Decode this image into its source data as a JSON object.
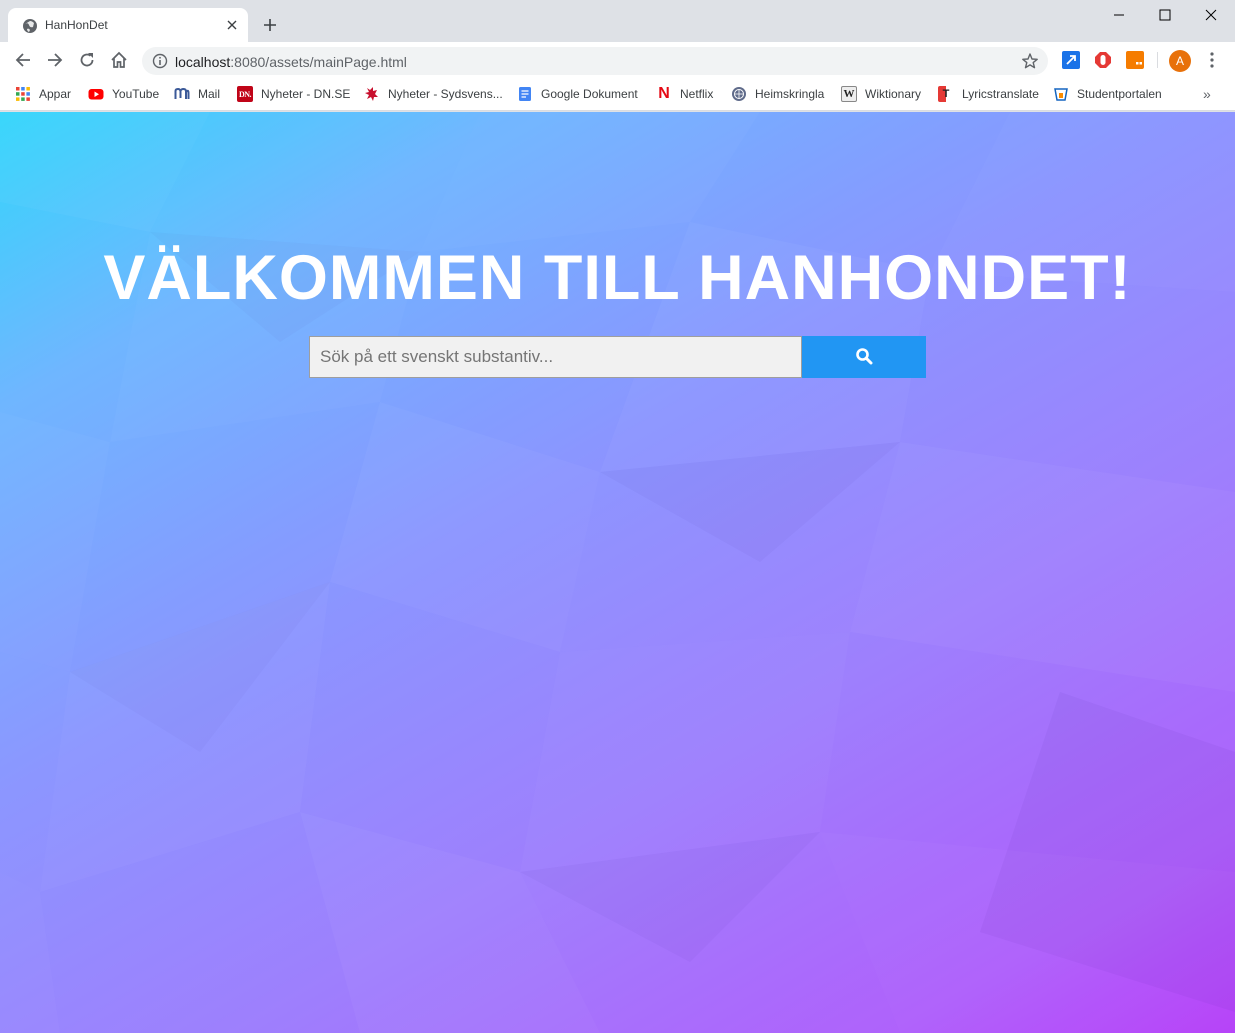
{
  "browser": {
    "tab": {
      "title": "HanHonDet"
    },
    "address": {
      "host": "localhost",
      "path": ":8080/assets/mainPage.html"
    },
    "profile_initial": "A",
    "more_bookmarks": "»"
  },
  "bookmarks": [
    {
      "label": "Appar",
      "icon": "apps-grid-icon"
    },
    {
      "label": "YouTube",
      "icon": "youtube-icon",
      "color": "#ff0000"
    },
    {
      "label": "Mail",
      "icon": "mail-icon",
      "color": "#3b5998"
    },
    {
      "label": "Nyheter - DN.SE",
      "icon": "dn-icon",
      "icon_text": "DN.",
      "color": "#c00418"
    },
    {
      "label": "Nyheter - Sydsvens...",
      "icon": "sydsvenskan-icon",
      "color": "#c8102e"
    },
    {
      "label": "Google Dokument",
      "icon": "google-docs-icon",
      "color": "#4285f4"
    },
    {
      "label": "Netflix",
      "icon": "netflix-icon",
      "icon_text": "N",
      "color": "#e50914"
    },
    {
      "label": "Heimskringla",
      "icon": "heimskringla-icon",
      "color": "#5f6b8a"
    },
    {
      "label": "Wiktionary",
      "icon": "wiktionary-icon",
      "icon_text": "W"
    },
    {
      "label": "Lyricstranslate",
      "icon": "lyricstranslate-icon",
      "icon_text": "T",
      "color": "#e53935"
    },
    {
      "label": "Studentportalen",
      "icon": "studentportalen-icon",
      "color": "#1565c0"
    }
  ],
  "page": {
    "heading": "VÄLKOMMEN TILL HANHONDET!",
    "search": {
      "placeholder": "Sök på ett svenskt substantiv...",
      "value": ""
    },
    "colors": {
      "search_button": "#2196f3",
      "heading": "#ffffff"
    }
  }
}
